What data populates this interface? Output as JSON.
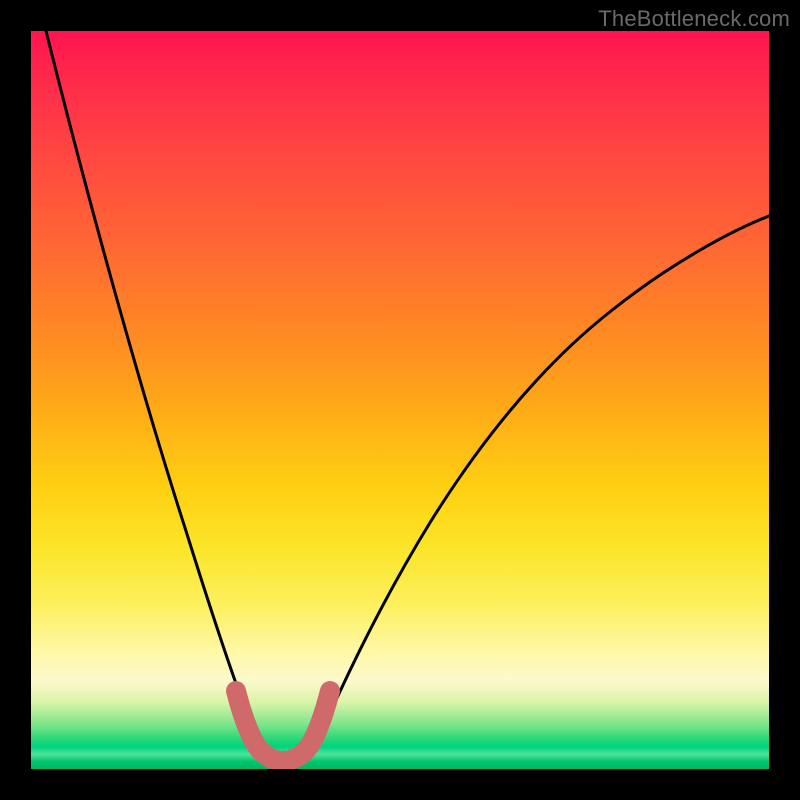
{
  "watermark": "TheBottleneck.com",
  "chart_data": {
    "type": "line",
    "title": "",
    "xlabel": "",
    "ylabel": "",
    "xlim": [
      0,
      100
    ],
    "ylim": [
      0,
      100
    ],
    "series": [
      {
        "name": "bottleneck-curve",
        "x": [
          2,
          5,
          8,
          11,
          14,
          17,
          20,
          23,
          25,
          27,
          28.5,
          30,
          31,
          32,
          33,
          35,
          37,
          39,
          42,
          46,
          50,
          55,
          60,
          65,
          70,
          76,
          82,
          88,
          94,
          100
        ],
        "values": [
          100,
          90,
          80,
          70,
          60,
          50,
          41,
          32,
          24,
          17,
          11,
          6,
          3.5,
          2.5,
          2.5,
          2.5,
          3.5,
          6,
          10,
          17,
          24,
          32,
          39,
          46,
          52,
          58,
          63,
          68,
          72,
          75
        ]
      },
      {
        "name": "bottleneck-highlight",
        "x": [
          27,
          28,
          29,
          30,
          31,
          32,
          33,
          34,
          35,
          36,
          37,
          38,
          39,
          40
        ],
        "values": [
          16,
          12,
          9,
          6,
          4,
          3,
          2.5,
          2.5,
          2.5,
          3,
          4,
          6,
          8,
          11
        ]
      }
    ],
    "gradient_stops": [
      {
        "pos": 0,
        "color": "#ff1450"
      },
      {
        "pos": 50,
        "color": "#ffad16"
      },
      {
        "pos": 80,
        "color": "#fff8a6"
      },
      {
        "pos": 95,
        "color": "#24d877"
      },
      {
        "pos": 100,
        "color": "#00b85e"
      }
    ]
  }
}
